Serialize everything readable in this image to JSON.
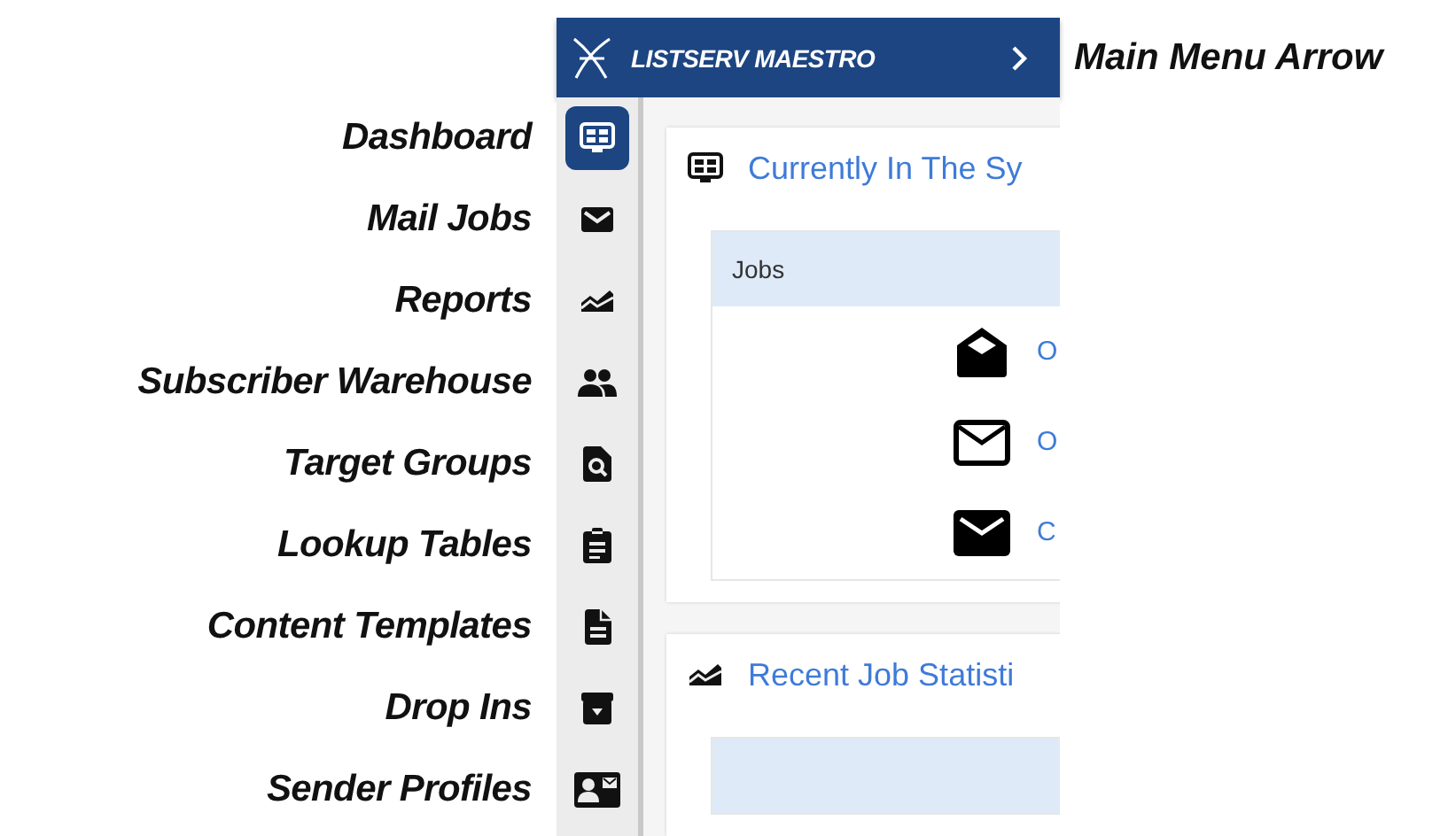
{
  "header": {
    "brand": "LISTSERV MAESTRO"
  },
  "annotation": {
    "label": "Main Menu Arrow"
  },
  "sidebar": {
    "items": [
      {
        "label": "Dashboard",
        "kind": "dashboard",
        "selected": true
      },
      {
        "label": "Mail Jobs",
        "kind": "mail",
        "selected": false
      },
      {
        "label": "Reports",
        "kind": "chart",
        "selected": false
      },
      {
        "label": "Subscriber Warehouse",
        "kind": "people",
        "selected": false
      },
      {
        "label": "Target Groups",
        "kind": "search",
        "selected": false
      },
      {
        "label": "Lookup Tables",
        "kind": "clipboard",
        "selected": false
      },
      {
        "label": "Content Templates",
        "kind": "document",
        "selected": false
      },
      {
        "label": "Drop Ins",
        "kind": "archive",
        "selected": false
      },
      {
        "label": "Sender Profiles",
        "kind": "contact",
        "selected": false
      }
    ]
  },
  "cards": [
    {
      "title": "Currently In The Sy",
      "kind": "dashboard",
      "table": {
        "header": "Jobs",
        "rows": [
          {
            "kind": "open",
            "link": "O"
          },
          {
            "kind": "outline",
            "link": "O"
          },
          {
            "kind": "closed",
            "link": "C"
          }
        ]
      }
    },
    {
      "title": "Recent Job Statisti",
      "kind": "chart"
    }
  ]
}
